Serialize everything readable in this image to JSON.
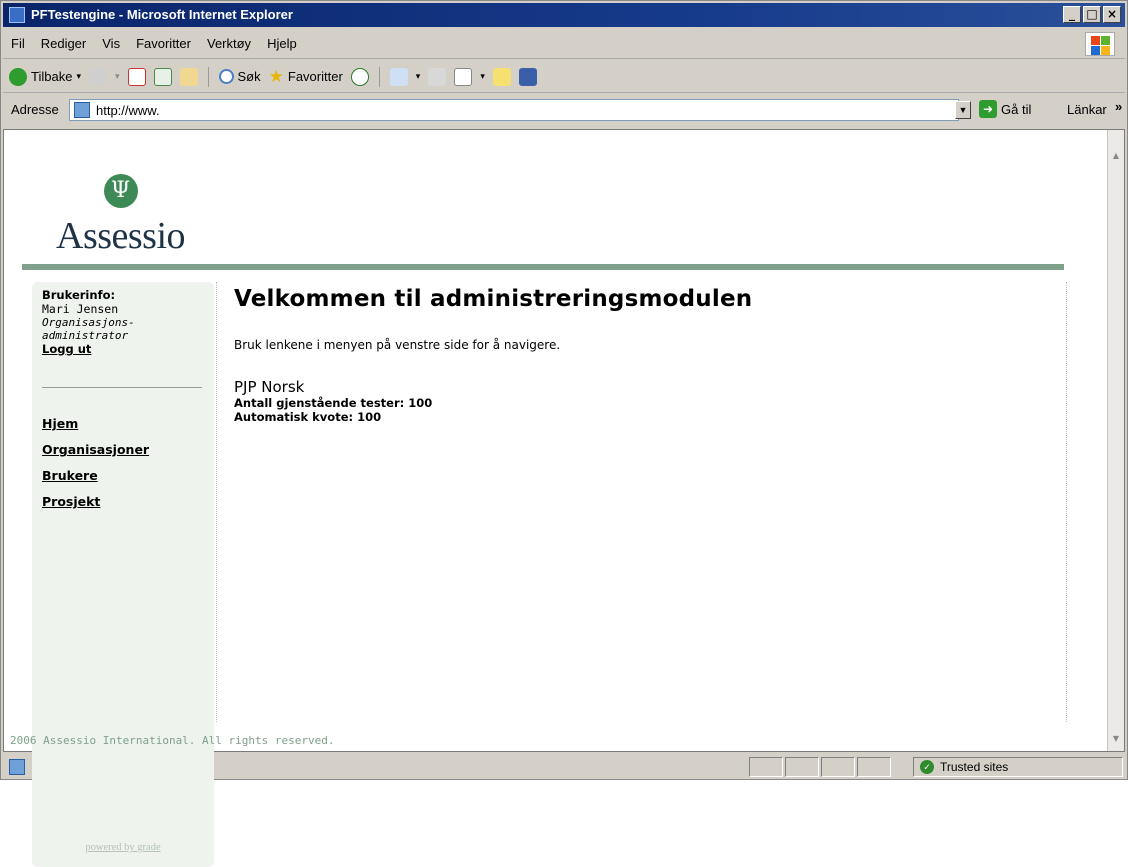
{
  "window": {
    "title": "PFTestengine - Microsoft Internet Explorer",
    "buttons": [
      "_",
      "□",
      "×"
    ]
  },
  "menu": [
    "Fil",
    "Rediger",
    "Vis",
    "Favoritter",
    "Verktøy",
    "Hjelp"
  ],
  "toolbar": {
    "back_label": "Tilbake",
    "search_label": "Søk",
    "favorites_label": "Favoritter"
  },
  "address": {
    "label": "Adresse",
    "url": "http://www.",
    "go_label": "Gå til",
    "links_label": "Länkar",
    "links_chevron": "»"
  },
  "logo": {
    "symbol": "Ψ",
    "name": "Assessio"
  },
  "sidebar": {
    "user_info_label": "Brukerinfo:",
    "user_name": "Mari Jensen",
    "role_line1": "Organisasjons-",
    "role_line2": "administrator",
    "logout": "Logg ut",
    "nav": [
      "Hjem",
      "Organisasjoner",
      "Brukere",
      "Prosjekt"
    ],
    "powered_by": "powered by grade"
  },
  "main": {
    "heading": "Velkommen til administreringsmodulen",
    "intro": "Bruk lenkene i menyen på venstre side for å navigere.",
    "product": "PJP Norsk",
    "remaining_tests": "Antall gjenstående tester:  100",
    "auto_quota": "Automatisk kvote:  100"
  },
  "footer": "2006 Assessio International. All rights reserved.",
  "status": {
    "zone": "Trusted sites"
  },
  "colors": {
    "accent_green": "#7fa08a",
    "logo_green": "#3e8a57",
    "titlebar": "#0a246a"
  }
}
